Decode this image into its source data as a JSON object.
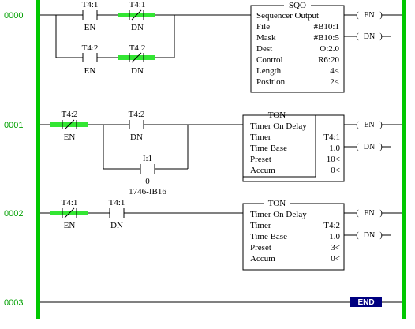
{
  "colors": {
    "rail": "#00c800",
    "energized_highlight": "#33e633",
    "rung_number": "#00a000",
    "end_marker": "#000080"
  },
  "rungs": [
    {
      "number": "0000",
      "contacts": [
        {
          "address": "T4:1",
          "bit": "EN",
          "type": "XIC"
        },
        {
          "address": "T4:1",
          "bit": "DN",
          "type": "XIO"
        },
        {
          "address": "T4:2",
          "bit": "EN",
          "type": "XIC"
        },
        {
          "address": "T4:2",
          "bit": "DN",
          "type": "XIO"
        }
      ],
      "box": {
        "mnemonic": "SQO",
        "title": "Sequencer Output",
        "rows": [
          {
            "label": "File",
            "value": "#B10:1"
          },
          {
            "label": "Mask",
            "value": "#B10:5"
          },
          {
            "label": "Dest",
            "value": "O:2.0"
          },
          {
            "label": "Control",
            "value": "R6:20"
          },
          {
            "label": "Length",
            "value": "4<"
          },
          {
            "label": "Position",
            "value": "2<"
          }
        ]
      },
      "outputs": [
        "EN",
        "DN"
      ]
    },
    {
      "number": "0001",
      "contacts": [
        {
          "address": "T4:2",
          "bit": "EN",
          "type": "XIO"
        },
        {
          "address": "T4:2",
          "bit": "DN",
          "type": "XIC"
        },
        {
          "address": "I:1",
          "bit": "0",
          "type": "XIC",
          "module": "1746-IB16"
        }
      ],
      "box": {
        "mnemonic": "TON",
        "title": "Timer On Delay",
        "rows": [
          {
            "label": "Timer",
            "value": "T4:1"
          },
          {
            "label": "Time Base",
            "value": "1.0"
          },
          {
            "label": "Preset",
            "value": "10<"
          },
          {
            "label": "Accum",
            "value": "0<"
          }
        ]
      },
      "outputs": [
        "EN",
        "DN"
      ]
    },
    {
      "number": "0002",
      "contacts": [
        {
          "address": "T4:1",
          "bit": "EN",
          "type": "XIO"
        },
        {
          "address": "T4:1",
          "bit": "DN",
          "type": "XIC"
        }
      ],
      "box": {
        "mnemonic": "TON",
        "title": "Timer On Delay",
        "rows": [
          {
            "label": "Timer",
            "value": "T4:2"
          },
          {
            "label": "Time Base",
            "value": "1.0"
          },
          {
            "label": "Preset",
            "value": "3<"
          },
          {
            "label": "Accum",
            "value": "0<"
          }
        ]
      },
      "outputs": [
        "EN",
        "DN"
      ]
    },
    {
      "number": "0003",
      "end_label": "END"
    }
  ]
}
